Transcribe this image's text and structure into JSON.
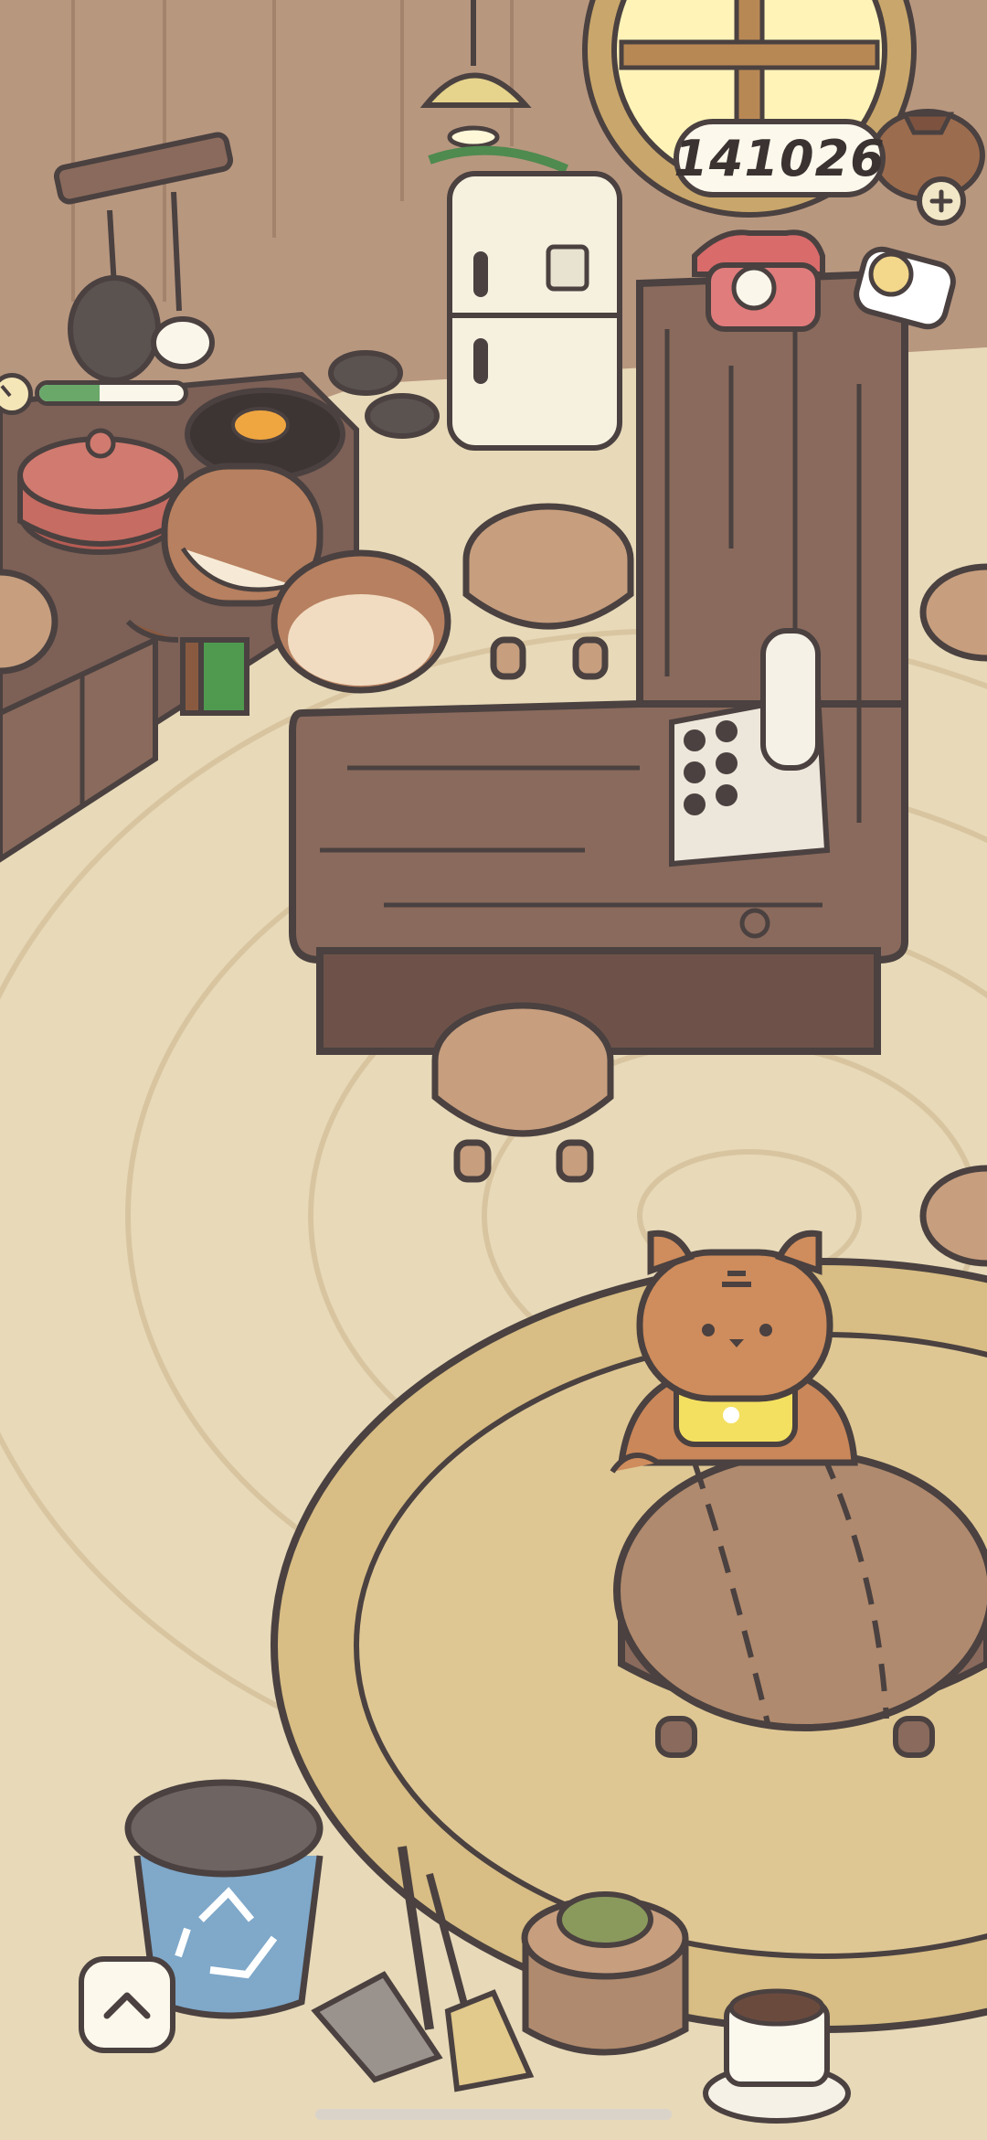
{
  "hud": {
    "coin_count": "141026",
    "coin_icon": "coin-bag-icon",
    "add_coins_icon": "plus-icon",
    "menu_toggle_icon": "chevron-up-icon"
  },
  "cooking": {
    "timer_icon": "clock-icon",
    "progress": 0.42
  },
  "colors": {
    "outline": "#4a4140",
    "floor": "#e8d9b8",
    "wall": "#b8977f",
    "wood_dark": "#8a6a5c",
    "rug": "#d8bd84",
    "progress_green": "#6aa86a"
  }
}
